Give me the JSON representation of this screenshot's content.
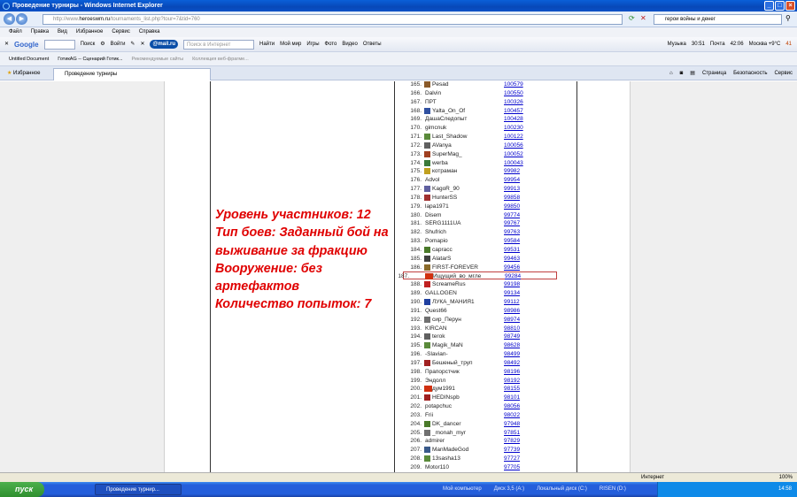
{
  "window": {
    "title": "Проведение турниры - Windows Internet Explorer"
  },
  "address": {
    "prefix": "http://www.",
    "domain": "heroeswm.ru",
    "rest": "/tournaments_list.php?tour=7&tid=760",
    "search_text": "герои войны и денег"
  },
  "menu": [
    "Файл",
    "Правка",
    "Вид",
    "Избранное",
    "Сервис",
    "Справка"
  ],
  "toolbar": {
    "google": "Google",
    "search": "Поиск",
    "login": "Войти",
    "mailru": "@mail.ru",
    "internet_search_placeholder": "Поиск в Интернет",
    "find": "Найти",
    "items": [
      "Мой мир",
      "Игры",
      "Фото",
      "Видео",
      "Ответы"
    ],
    "music": "Музыка",
    "time1": "30:51",
    "mail": "Почта",
    "time2": "42:06",
    "weather": "Москва +9°С",
    "count": "41"
  },
  "links_bar": [
    "Untitled Document",
    "ГотикАG -- Сценарий Готик...",
    "Рекомендуемые сайты",
    "Коллекция веб-фрагме..."
  ],
  "tabbar": {
    "favorites": "Избранное",
    "tab": "Проведение турниры",
    "commands": [
      "Страница",
      "Безопасность",
      "Сервис"
    ]
  },
  "info": [
    "Уровень участников: 12",
    "Тип боев: Заданный бой на выживание за фракцию",
    "Вооружение: без артефактов",
    "Количество попыток: 7"
  ],
  "rows": [
    {
      "n": "165.",
      "name": "Pesad",
      "score": "100579",
      "icon": "clan",
      "c": "#8a5a2a"
    },
    {
      "n": "166.",
      "name": "Dalvin",
      "score": "100550",
      "icon": "",
      "c": ""
    },
    {
      "n": "167.",
      "name": "ПРТ",
      "score": "100326",
      "icon": "",
      "c": ""
    },
    {
      "n": "168.",
      "name": "Yalta_On_Of",
      "score": "100457",
      "icon": "clan",
      "c": "#3050a0"
    },
    {
      "n": "169.",
      "name": "ДашаСледопыт",
      "score": "100428",
      "icon": "",
      "c": ""
    },
    {
      "n": "170.",
      "name": "gimcnuk",
      "score": "100230",
      "icon": "",
      "c": ""
    },
    {
      "n": "171.",
      "name": "Last_Shadow",
      "score": "100122",
      "icon": "clan",
      "c": "#5a8a3a"
    },
    {
      "n": "172.",
      "name": "AVanya",
      "score": "100056",
      "icon": "clan",
      "c": "#606060"
    },
    {
      "n": "173.",
      "name": "SuperMag_",
      "score": "100052",
      "icon": "clan",
      "c": "#a04020"
    },
    {
      "n": "174.",
      "name": "werba",
      "score": "100043",
      "icon": "clan",
      "c": "#3a7a3a"
    },
    {
      "n": "175.",
      "name": "котраман",
      "score": "99982",
      "icon": "clan",
      "c": "#c0a020"
    },
    {
      "n": "176.",
      "name": "Advol",
      "score": "99954",
      "icon": "",
      "c": ""
    },
    {
      "n": "177.",
      "name": "KagoR_90",
      "score": "99913",
      "icon": "clan",
      "c": "#6060a0"
    },
    {
      "n": "178.",
      "name": "HunterSS",
      "score": "99858",
      "icon": "clan",
      "c": "#a03030"
    },
    {
      "n": "179.",
      "name": "lapa1971",
      "score": "99850",
      "icon": "",
      "c": ""
    },
    {
      "n": "180.",
      "name": "Disem",
      "score": "99774",
      "icon": "",
      "c": ""
    },
    {
      "n": "181.",
      "name": "SERG1111UA",
      "score": "99767",
      "icon": "",
      "c": ""
    },
    {
      "n": "182.",
      "name": "Shufrich",
      "score": "99763",
      "icon": "",
      "c": ""
    },
    {
      "n": "183.",
      "name": "Pomapio",
      "score": "99584",
      "icon": "",
      "c": ""
    },
    {
      "n": "184.",
      "name": "capracc",
      "score": "99531",
      "icon": "clan",
      "c": "#4a7a2a"
    },
    {
      "n": "185.",
      "name": "AlatarS",
      "score": "99463",
      "icon": "clan",
      "c": "#404040"
    },
    {
      "n": "186.",
      "name": "FIRST-FOREVER",
      "score": "99456",
      "icon": "clan",
      "c": "#8a6a2a"
    },
    {
      "n": "187.",
      "name": "Ищущий_во_мгле",
      "score": "99284",
      "icon": "tp",
      "c": "#d03010"
    },
    {
      "n": "188.",
      "name": "ScreameRus",
      "score": "99198",
      "icon": "clan",
      "c": "#c02020"
    },
    {
      "n": "189.",
      "name": "GALLOGEN",
      "score": "99134",
      "icon": "",
      "c": ""
    },
    {
      "n": "190.",
      "name": "ЛУКА_МАНИЯ1",
      "score": "99112",
      "icon": "clan",
      "c": "#2040a0"
    },
    {
      "n": "191.",
      "name": "Quest66",
      "score": "98986",
      "icon": "",
      "c": ""
    },
    {
      "n": "192.",
      "name": "сир_Перун",
      "score": "98974",
      "icon": "clan",
      "c": "#707070"
    },
    {
      "n": "193.",
      "name": "KIRCAN",
      "score": "98810",
      "icon": "",
      "c": ""
    },
    {
      "n": "194.",
      "name": "terok",
      "score": "98749",
      "icon": "clan",
      "c": "#606060"
    },
    {
      "n": "195.",
      "name": "Magik_MaN",
      "score": "98628",
      "icon": "clan",
      "c": "#5a8a3a"
    },
    {
      "n": "196.",
      "name": "-Slavian-",
      "score": "98499",
      "icon": "",
      "c": ""
    },
    {
      "n": "197.",
      "name": "Бешеный_труп",
      "score": "98492",
      "icon": "clan",
      "c": "#a02020"
    },
    {
      "n": "198.",
      "name": "Прапорстчик",
      "score": "98196",
      "icon": "",
      "c": ""
    },
    {
      "n": "199.",
      "name": "Эндолл",
      "score": "98192",
      "icon": "",
      "c": ""
    },
    {
      "n": "200.",
      "name": "дум1991",
      "score": "98155",
      "icon": "tp",
      "c": "#d03010"
    },
    {
      "n": "201.",
      "name": "HEDINspb",
      "score": "98101",
      "icon": "clan",
      "c": "#a02020"
    },
    {
      "n": "202.",
      "name": "potapchuc",
      "score": "98056",
      "icon": "",
      "c": ""
    },
    {
      "n": "203.",
      "name": "Frii",
      "score": "98022",
      "icon": "",
      "c": ""
    },
    {
      "n": "204.",
      "name": "DK_dancer",
      "score": "97948",
      "icon": "clan",
      "c": "#4a7a2a"
    },
    {
      "n": "205.",
      "name": "_monah_myr",
      "score": "97851",
      "icon": "clan",
      "c": "#707070"
    },
    {
      "n": "206.",
      "name": "admirer",
      "score": "97829",
      "icon": "",
      "c": ""
    },
    {
      "n": "207.",
      "name": "ManMadeGod",
      "score": "97739",
      "icon": "clan",
      "c": "#3a5a8a"
    },
    {
      "n": "208.",
      "name": "13sasha13",
      "score": "97727",
      "icon": "clan",
      "c": "#5a8a3a"
    },
    {
      "n": "209.",
      "name": "Motor110",
      "score": "97705",
      "icon": "",
      "c": ""
    }
  ],
  "status": {
    "zone": "Интернет",
    "zoom": "100%"
  },
  "taskbar": {
    "start": "пуск",
    "task": "Проведение турнир...",
    "items": [
      "Мой компьютер",
      "Диск 3,5 (A:)",
      "Локальный диск (C:)",
      "RISEN (D:)"
    ],
    "clock": "14:58"
  }
}
